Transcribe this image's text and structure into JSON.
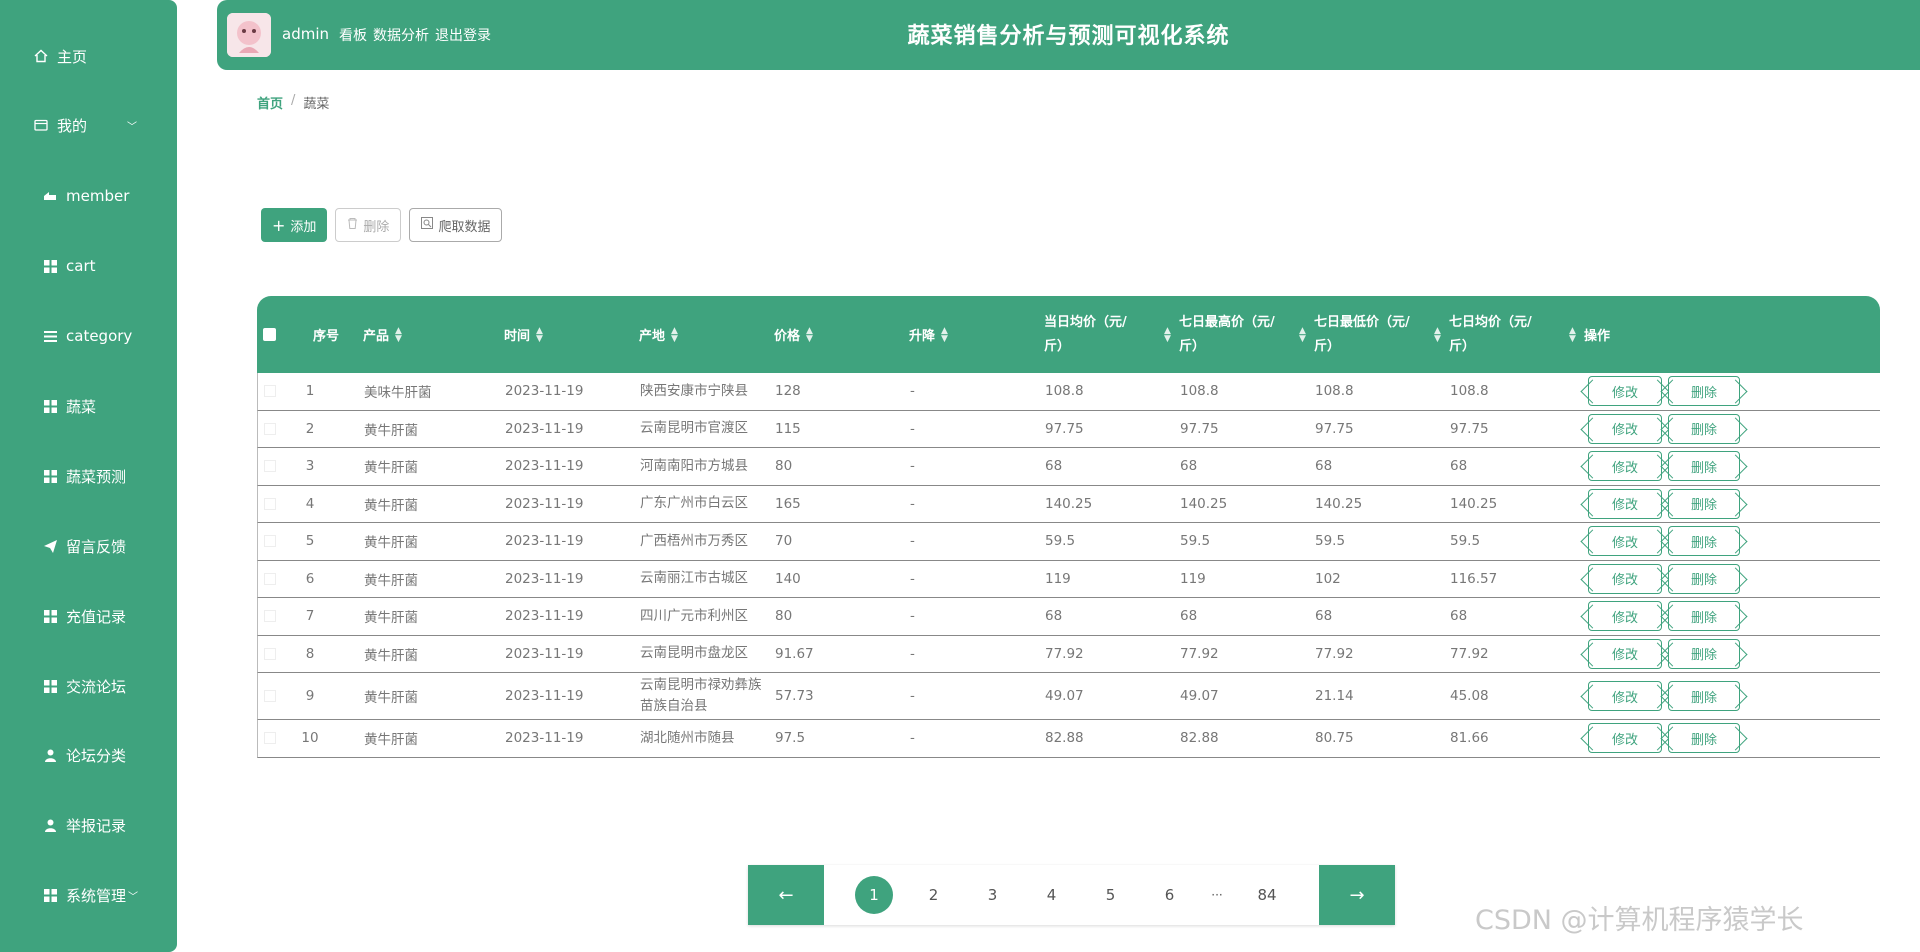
{
  "sidebar": {
    "items": [
      {
        "label": "主页",
        "icon": "home-icon"
      },
      {
        "label": "我的",
        "icon": "wallet-icon"
      },
      {
        "label": "member",
        "icon": "member-icon"
      },
      {
        "label": "cart",
        "icon": "grid-icon"
      },
      {
        "label": "category",
        "icon": "list-icon"
      },
      {
        "label": "蔬菜",
        "icon": "grid-icon"
      },
      {
        "label": "蔬菜预测",
        "icon": "grid-icon"
      },
      {
        "label": "留言反馈",
        "icon": "send-icon"
      },
      {
        "label": "充值记录",
        "icon": "grid-icon"
      },
      {
        "label": "交流论坛",
        "icon": "grid-icon"
      },
      {
        "label": "论坛分类",
        "icon": "user-icon"
      },
      {
        "label": "举报记录",
        "icon": "user-icon"
      },
      {
        "label": "系统管理",
        "icon": "grid-icon"
      }
    ]
  },
  "header": {
    "user": "admin",
    "nav": [
      "看板",
      "数据分析",
      "退出登录"
    ],
    "title": "蔬菜销售分析与预测可视化系统"
  },
  "breadcrumb": {
    "home": "首页",
    "sep": "/",
    "current": "蔬菜"
  },
  "toolbar": {
    "add": "添加",
    "delete": "删除",
    "crawl": "爬取数据"
  },
  "table": {
    "headers": {
      "index": "序号",
      "product": "产品",
      "time": "时间",
      "origin": "产地",
      "price": "价格",
      "change": "升降",
      "avg_today": "当日均价（元/斤）",
      "max7": "七日最高价（元/斤）",
      "min7": "七日最低价（元/斤）",
      "avg7": "七日均价（元/斤）",
      "ops": "操作"
    },
    "edit_label": "修改",
    "delete_label": "删除",
    "rows": [
      {
        "index": "1",
        "product": "美味牛肝菌",
        "time": "2023-11-19",
        "origin": "陕西安康市宁陕县",
        "price": "128",
        "change": "-",
        "avg_today": "108.8",
        "max7": "108.8",
        "min7": "108.8",
        "avg7": "108.8"
      },
      {
        "index": "2",
        "product": "黄牛肝菌",
        "time": "2023-11-19",
        "origin": "云南昆明市官渡区",
        "price": "115",
        "change": "-",
        "avg_today": "97.75",
        "max7": "97.75",
        "min7": "97.75",
        "avg7": "97.75"
      },
      {
        "index": "3",
        "product": "黄牛肝菌",
        "time": "2023-11-19",
        "origin": "河南南阳市方城县",
        "price": "80",
        "change": "-",
        "avg_today": "68",
        "max7": "68",
        "min7": "68",
        "avg7": "68"
      },
      {
        "index": "4",
        "product": "黄牛肝菌",
        "time": "2023-11-19",
        "origin": "广东广州市白云区",
        "price": "165",
        "change": "-",
        "avg_today": "140.25",
        "max7": "140.25",
        "min7": "140.25",
        "avg7": "140.25"
      },
      {
        "index": "5",
        "product": "黄牛肝菌",
        "time": "2023-11-19",
        "origin": "广西梧州市万秀区",
        "price": "70",
        "change": "-",
        "avg_today": "59.5",
        "max7": "59.5",
        "min7": "59.5",
        "avg7": "59.5"
      },
      {
        "index": "6",
        "product": "黄牛肝菌",
        "time": "2023-11-19",
        "origin": "云南丽江市古城区",
        "price": "140",
        "change": "-",
        "avg_today": "119",
        "max7": "119",
        "min7": "102",
        "avg7": "116.57"
      },
      {
        "index": "7",
        "product": "黄牛肝菌",
        "time": "2023-11-19",
        "origin": "四川广元市利州区",
        "price": "80",
        "change": "-",
        "avg_today": "68",
        "max7": "68",
        "min7": "68",
        "avg7": "68"
      },
      {
        "index": "8",
        "product": "黄牛肝菌",
        "time": "2023-11-19",
        "origin": "云南昆明市盘龙区",
        "price": "91.67",
        "change": "-",
        "avg_today": "77.92",
        "max7": "77.92",
        "min7": "77.92",
        "avg7": "77.92"
      },
      {
        "index": "9",
        "product": "黄牛肝菌",
        "time": "2023-11-19",
        "origin": "云南昆明市禄劝彝族苗族自治县",
        "price": "57.73",
        "change": "-",
        "avg_today": "49.07",
        "max7": "49.07",
        "min7": "21.14",
        "avg7": "45.08"
      },
      {
        "index": "10",
        "product": "黄牛肝菌",
        "time": "2023-11-19",
        "origin": "湖北随州市随县",
        "price": "97.5",
        "change": "-",
        "avg_today": "82.88",
        "max7": "82.88",
        "min7": "80.75",
        "avg7": "81.66"
      }
    ]
  },
  "pagination": {
    "prev": "←",
    "next": "→",
    "pages": [
      "1",
      "2",
      "3",
      "4",
      "5",
      "6"
    ],
    "ellipsis": "···",
    "last": "84",
    "active": "1"
  },
  "watermark": "CSDN @计算机程序猿学长",
  "colors": {
    "accent": "#3fa37e",
    "white": "#ffffff"
  }
}
